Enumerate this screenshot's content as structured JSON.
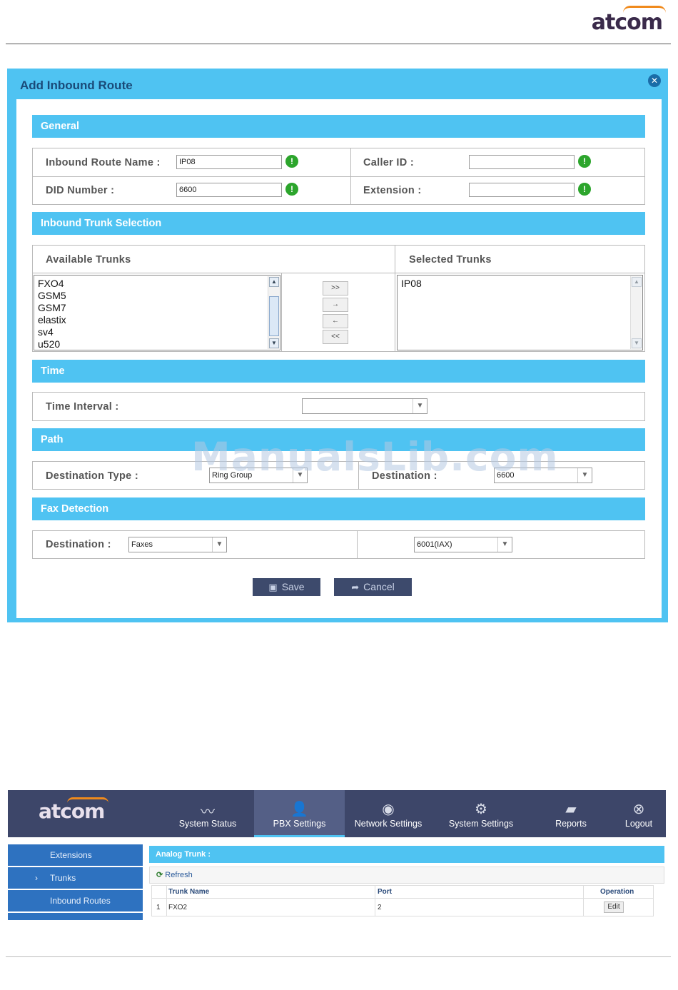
{
  "brand": {
    "logo_text": "atcom",
    "accent_color": "#f08a1c"
  },
  "dialog": {
    "title": "Add Inbound Route",
    "sections": {
      "general": "General",
      "trunks": "Inbound Trunk Selection",
      "time": "Time",
      "path": "Path",
      "fax": "Fax Detection"
    },
    "general": {
      "route_name_label": "Inbound Route Name :",
      "route_name_value": "IP08",
      "caller_id_label": "Caller ID :",
      "caller_id_value": "",
      "did_label": "DID Number :",
      "did_value": "6600",
      "extension_label": "Extension :",
      "extension_value": ""
    },
    "trunks": {
      "available_header": "Available Trunks",
      "selected_header": "Selected Trunks",
      "available": [
        "FXO4",
        "GSM5",
        "GSM7",
        "elastix",
        "sv4",
        "u520"
      ],
      "selected": [
        "IP08"
      ],
      "buttons": {
        "add_all": ">>",
        "add": "→",
        "remove": "←",
        "remove_all": "<<"
      }
    },
    "time": {
      "interval_label": "Time Interval :",
      "interval_value": ""
    },
    "path": {
      "dest_type_label": "Destination Type :",
      "dest_type_value": "Ring Group",
      "dest_label": "Destination :",
      "dest_value": "6600"
    },
    "fax": {
      "dest_label": "Destination :",
      "dest_value": "Faxes",
      "target_value": "6001(IAX)"
    },
    "save_label": "Save",
    "cancel_label": "Cancel"
  },
  "watermark": "ManualsLib.com",
  "app": {
    "logo_text": "atcom",
    "nav": [
      {
        "label": "System Status",
        "icon": "chart-line-icon"
      },
      {
        "label": "PBX Settings",
        "icon": "add-user-icon"
      },
      {
        "label": "Network Settings",
        "icon": "globe-icon"
      },
      {
        "label": "System Settings",
        "icon": "gear-icon"
      },
      {
        "label": "Reports",
        "icon": "chat-icon"
      },
      {
        "label": "Logout",
        "icon": "close-circle-icon"
      }
    ],
    "sidebar": [
      "Extensions",
      "Trunks",
      "Inbound Routes"
    ],
    "panel_title": "Analog Trunk :",
    "refresh_label": "Refresh",
    "table": {
      "headers": [
        "Trunk Name",
        "Port",
        "Operation"
      ],
      "rows": [
        {
          "index": "1",
          "name": "FXO2",
          "port": "2",
          "op": "Edit"
        }
      ]
    }
  }
}
